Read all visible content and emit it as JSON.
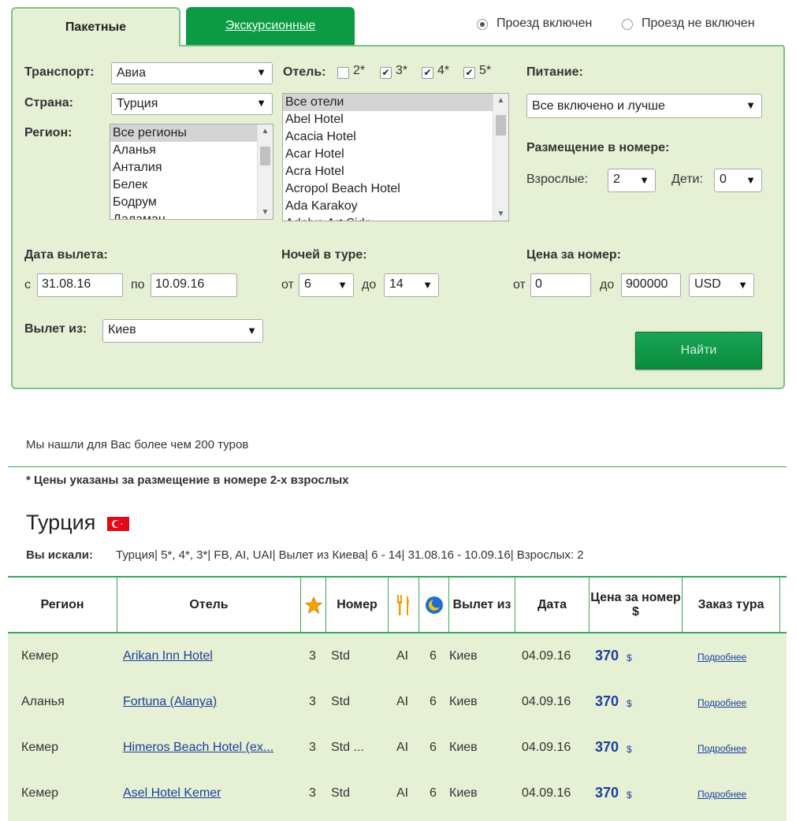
{
  "tabs": {
    "packages": "Пакетные",
    "excursion": "Экскурсионные"
  },
  "travel_options": {
    "included": "Проезд включен",
    "not_included": "Проезд не включен"
  },
  "form": {
    "transport_label": "Транспорт:",
    "transport_value": "Авиа",
    "country_label": "Страна:",
    "country_value": "Турция",
    "region_label": "Регион:",
    "regions": [
      "Все регионы",
      "Аланья",
      "Анталия",
      "Белек",
      "Бодрум",
      "Даламан"
    ],
    "hotel_label": "Отель:",
    "stars": [
      "2*",
      "3*",
      "4*",
      "5*"
    ],
    "hotels": [
      "Все отели",
      "Abel Hotel",
      "Acacia Hotel",
      "Acar Hotel",
      "Acra Hotel",
      "Acropol Beach Hotel",
      "Ada Karakoy",
      "Adalya Art Side"
    ],
    "meal_label": "Питание:",
    "meal_value": "Все включено и лучше",
    "room_label": "Размещение в номере:",
    "adults_label": "Взрослые:",
    "adults_value": "2",
    "kids_label": "Дети:",
    "kids_value": "0",
    "departure_date_label": "Дата вылета:",
    "from_c": "с",
    "date_from": "31.08.16",
    "to_po": "по",
    "date_to": "10.09.16",
    "nights_label": "Ночей в туре:",
    "from_ot": "от",
    "nights_from": "6",
    "to_do": "до",
    "nights_to": "14",
    "price_label": "Цена за номер:",
    "price_from": "0",
    "price_to": "900000",
    "currency": "USD",
    "departure_from_label": "Вылет из:",
    "departure_city": "Киев",
    "find_button": "Найти"
  },
  "results": {
    "found_text": "Мы нашли для Вас более чем 200 туров",
    "note": "*  Цены указаны за размещение в номере 2-х взрослых",
    "country_title": "Турция",
    "searched_label": "Вы искали:",
    "searched_value": "Турция| 5*, 4*, 3*| FB, AI, UAI| Вылет из Киева| 6 - 14| 31.08.16 - 10.09.16| Взрослых: 2"
  },
  "table": {
    "headers": {
      "region": "Регион",
      "hotel": "Отель",
      "room": "Номер",
      "departure": "Вылет из",
      "date": "Дата",
      "price": "Цена за номер $",
      "order": "Заказ тура"
    },
    "rows": [
      {
        "region": "Кемер",
        "hotel": "Arikan Inn Hotel",
        "stars": "3",
        "room": "Std",
        "meal": "AI",
        "nights": "6",
        "city": "Киев",
        "date": "04.09.16",
        "price": "370",
        "cur": "$",
        "more": "Подробнее"
      },
      {
        "region": "Аланья",
        "hotel": "Fortuna (Alanya)",
        "stars": "3",
        "room": "Std",
        "meal": "AI",
        "nights": "6",
        "city": "Киев",
        "date": "04.09.16",
        "price": "370",
        "cur": "$",
        "more": "Подробнее"
      },
      {
        "region": "Кемер",
        "hotel": "Himeros Beach Hotel (ex...",
        "stars": "3",
        "room": "Std ...",
        "meal": "AI",
        "nights": "6",
        "city": "Киев",
        "date": "04.09.16",
        "price": "370",
        "cur": "$",
        "more": "Подробнее"
      },
      {
        "region": "Кемер",
        "hotel": "Asel Hotel Kemer",
        "stars": "3",
        "room": "Std",
        "meal": "AI",
        "nights": "6",
        "city": "Киев",
        "date": "04.09.16",
        "price": "370",
        "cur": "$",
        "more": "Подробнее"
      }
    ]
  },
  "colors": {
    "panel_bg": "#e6f0d4",
    "accent_green": "#0d9a45",
    "border_green": "#7bc28a",
    "link_blue": "#1a3fa0"
  }
}
